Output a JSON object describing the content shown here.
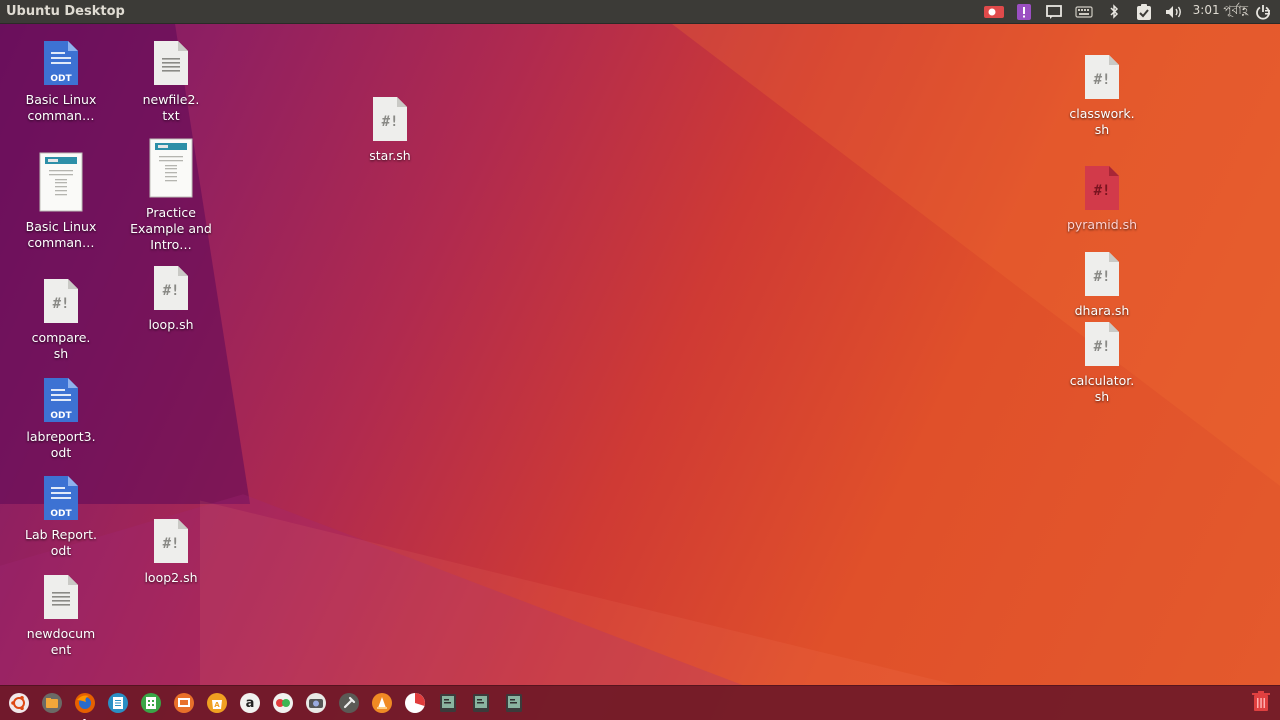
{
  "panel": {
    "title": "Ubuntu Desktop",
    "clock": "3:01 পূর্বাহ্ণ"
  },
  "desktop": {
    "icons": [
      {
        "label": "Basic Linux comman…",
        "type": "odt",
        "name": "basic-linux-commands-odt"
      },
      {
        "label": "Basic Linux comman…",
        "type": "doc-thumb",
        "name": "basic-linux-commands-pdf"
      },
      {
        "label": "compare.\nsh",
        "type": "sh",
        "name": "compare-sh"
      },
      {
        "label": "labreport3.\nodt",
        "type": "odt",
        "name": "labreport3-odt"
      },
      {
        "label": "Lab Report.\nodt",
        "type": "odt",
        "name": "lab-report-odt"
      },
      {
        "label": "newdocum\nent",
        "type": "txt",
        "name": "newdocument"
      },
      {
        "label": "newfile2.\ntxt",
        "type": "txt",
        "name": "newfile2-txt"
      },
      {
        "label": "Practice Example and Intro…",
        "type": "doc-thumb",
        "name": "practice-example-pdf"
      },
      {
        "label": "loop.sh",
        "type": "sh",
        "name": "loop-sh"
      },
      {
        "label": "loop2.sh",
        "type": "sh",
        "name": "loop2-sh"
      },
      {
        "label": "star.sh",
        "type": "sh",
        "name": "star-sh"
      },
      {
        "label": "classwork.\nsh",
        "type": "sh",
        "name": "classwork-sh"
      },
      {
        "label": "pyramid.sh",
        "type": "sh",
        "name": "pyramid-sh",
        "selected": true
      },
      {
        "label": "dhara.sh",
        "type": "sh",
        "name": "dhara-sh"
      },
      {
        "label": "calculator.\nsh",
        "type": "sh",
        "name": "calculator-sh"
      }
    ]
  },
  "launcher": {
    "items": [
      {
        "icon": "ubuntu-logo-icon"
      },
      {
        "icon": "files-icon"
      },
      {
        "icon": "firefox-icon"
      },
      {
        "icon": "writer-icon"
      },
      {
        "icon": "calc-icon"
      },
      {
        "icon": "impress-icon"
      },
      {
        "icon": "software-center-icon"
      },
      {
        "icon": "amazon-icon"
      },
      {
        "icon": "kazam-icon"
      },
      {
        "icon": "screenshot-icon"
      },
      {
        "icon": "settings-icon"
      },
      {
        "icon": "vlc-icon"
      },
      {
        "icon": "disk-usage-icon"
      },
      {
        "icon": "terminal-icon"
      },
      {
        "icon": "terminal-icon"
      },
      {
        "icon": "terminal-icon"
      }
    ],
    "trash_icon": "trash-icon"
  },
  "colors": {
    "panel": "#3c3b37",
    "launcher": "#6e1928",
    "odt_blue": "#3d72d3",
    "selected_icon": "#c0283a"
  }
}
